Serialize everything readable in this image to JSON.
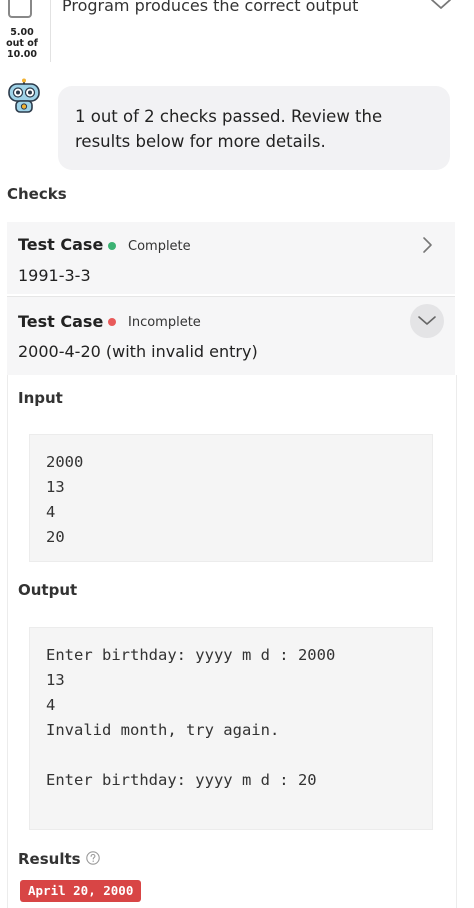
{
  "rubric": {
    "score_value": "5.00",
    "score_outof": "out of",
    "score_max": "10.00",
    "title": "Program produces the correct output"
  },
  "message": "1 out of 2 checks passed. Review the results below for more details.",
  "checks_title": "Checks",
  "cases": [
    {
      "title": "Test Case",
      "status": "Complete",
      "status_color": "#3bb273",
      "subtitle": "1991-3-3"
    },
    {
      "title": "Test Case",
      "status": "Incomplete",
      "status_color": "#e85a5a",
      "subtitle": "2000-4-20 (with invalid entry)"
    }
  ],
  "input_label": "Input",
  "input_text": "2000\n13\n4\n20",
  "output_label": "Output",
  "output_text": "Enter birthday: yyyy m d : 2000\n13\n4\nInvalid month, try again.\n\nEnter birthday: yyyy m d : 20",
  "results_label": "Results",
  "result_badge": "April 20, 2000",
  "colors": {
    "error_badge": "#d84545",
    "panel_bg": "#f6f6f7"
  }
}
